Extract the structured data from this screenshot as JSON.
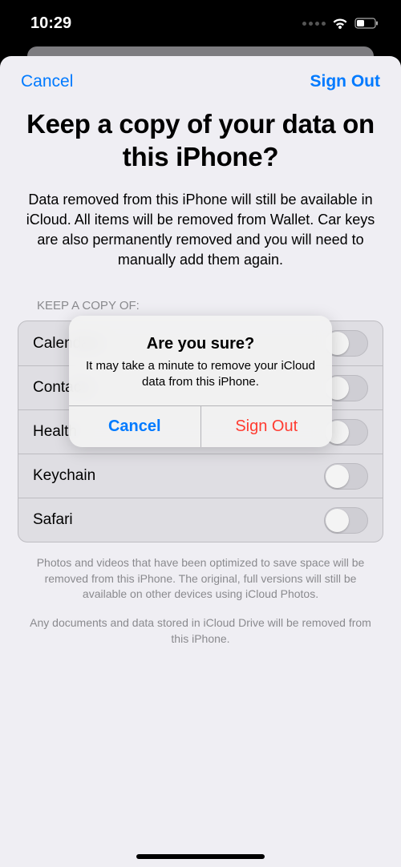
{
  "status": {
    "time": "10:29"
  },
  "sheet": {
    "nav": {
      "cancel": "Cancel",
      "sign_out": "Sign Out"
    },
    "title": "Keep a copy of your data on this iPhone?",
    "subtitle": "Data removed from this iPhone will still be available in iCloud. All items will be removed from Wallet. Car keys are also permanently removed and you will need to manually add them again.",
    "section_label": "KEEP A COPY OF:",
    "rows": {
      "calendars": "Calendars",
      "contacts": "Contacts",
      "health": "Health",
      "keychain": "Keychain",
      "safari": "Safari"
    },
    "footer1": "Photos and videos that have been optimized to save space will be removed from this iPhone. The original, full versions will still be available on other devices using iCloud Photos.",
    "footer2": "Any documents and data stored in iCloud Drive will be removed from this iPhone."
  },
  "alert": {
    "title": "Are you sure?",
    "message": "It may take a minute to remove your iCloud data from this iPhone.",
    "cancel": "Cancel",
    "sign_out": "Sign Out"
  }
}
